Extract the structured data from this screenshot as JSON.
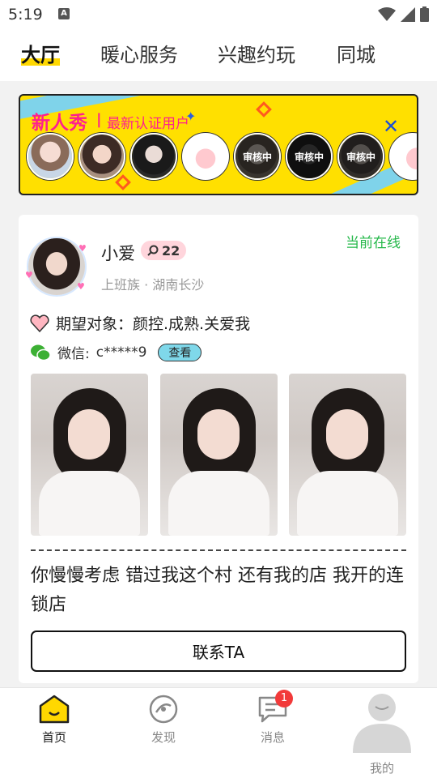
{
  "status_bar": {
    "time": "5:19",
    "notification_icon": "A"
  },
  "top_tabs": [
    {
      "label": "大厅",
      "active": true
    },
    {
      "label": "暖心服务",
      "active": false
    },
    {
      "label": "兴趣约玩",
      "active": false
    },
    {
      "label": "同城",
      "active": false
    }
  ],
  "banner": {
    "title": "新人秀",
    "separator": "|",
    "subtitle": "最新认证用户",
    "close_icon": "x-icon",
    "avatars": [
      {
        "name": "avatar-1",
        "review_label": ""
      },
      {
        "name": "avatar-2",
        "review_label": ""
      },
      {
        "name": "avatar-3",
        "review_label": ""
      },
      {
        "name": "avatar-4",
        "review_label": ""
      },
      {
        "name": "avatar-5",
        "review_label": "审核中"
      },
      {
        "name": "avatar-6",
        "review_label": "审核中"
      },
      {
        "name": "avatar-7",
        "review_label": "审核中"
      },
      {
        "name": "avatar-8",
        "review_label": ""
      }
    ]
  },
  "card": {
    "name": "小爱",
    "count": "22",
    "meta": "上班族 · 湖南长沙",
    "online_status": "当前在线",
    "expectation": "期望对象：颜控.成熟.关爱我",
    "wechat_label": "微信:",
    "wechat_value": "c*****9",
    "view_button": "查看",
    "bio": "你慢慢考虑 错过我这个村 还有我的店 我开的连锁店",
    "contact_button": "联系TA"
  },
  "bottom_nav": [
    {
      "label": "首页",
      "icon": "home-icon",
      "active": true
    },
    {
      "label": "发现",
      "icon": "discover-icon",
      "active": false
    },
    {
      "label": "消息",
      "icon": "message-icon",
      "active": false,
      "badge": "1"
    },
    {
      "label": "我的",
      "icon": "profile-icon",
      "active": false
    }
  ],
  "colors": {
    "accent": "#ffd800",
    "banner_pink": "#ff1f8e",
    "online_green": "#25b84a",
    "badge_red": "#f23a3a"
  }
}
